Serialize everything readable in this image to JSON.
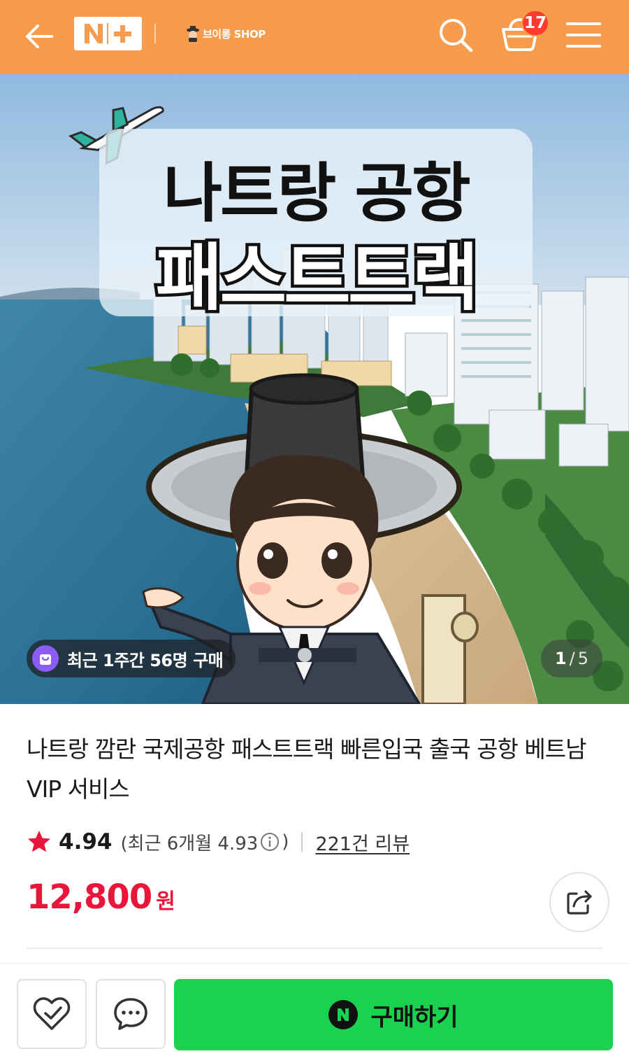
{
  "header": {
    "brand_badge": "N+",
    "shop_name": "브이롱 SHOP",
    "cart_count": "17",
    "colors": {
      "background": "#f79c4c",
      "badge": "#ff3b2f"
    }
  },
  "hero": {
    "title_line1": "나트랑 공항",
    "title_line2": "패스트트랙",
    "purchase_count": "최근 1주간 56명 구매",
    "page_current": "1",
    "page_separator": "/",
    "page_total": "5"
  },
  "product": {
    "title": "나트랑 깜란 국제공항 패스트트랙 빠른입국 출국 공항 베트남 VIP 서비스",
    "rating": "4.94",
    "recent_rating_prefix": "(최근 6개월 4.93",
    "recent_rating_suffix": ")",
    "review_count": "221건 리뷰",
    "price": "12,800",
    "price_unit": "원",
    "colors": {
      "price": "#e8163a",
      "star": "#e8163a"
    }
  },
  "bottom_bar": {
    "buy_label": "구매하기",
    "buy_color": "#19d34f"
  }
}
